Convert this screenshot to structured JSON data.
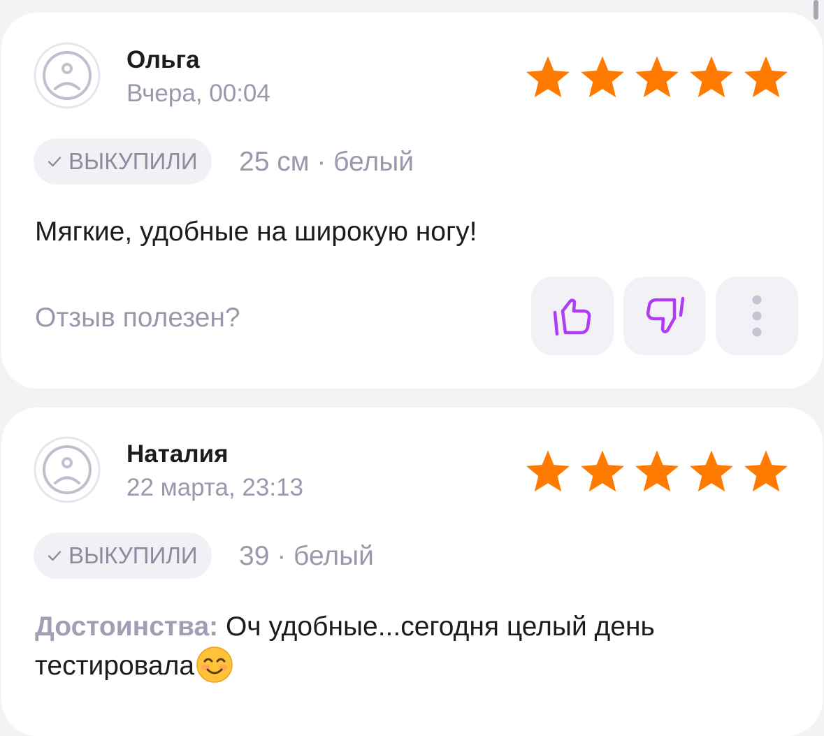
{
  "colors": {
    "star": "#ff7a00",
    "accent": "#b03cf5",
    "muted_text": "#9b98ad",
    "text": "#1c1c1e"
  },
  "reviews": [
    {
      "author": "Ольга",
      "date": "Вчера, 00:04",
      "rating": 5,
      "badge": "ВЫКУПИЛИ",
      "variant": "25 см · белый",
      "text": "Мягкие, удобные на широкую ногу!",
      "helpful_question": "Отзыв полезен?"
    },
    {
      "author": "Наталия",
      "date": "22 марта, 23:13",
      "rating": 5,
      "badge": "ВЫКУПИЛИ",
      "variant": "39 · белый",
      "pros_label": "Достоинства:",
      "pros_text": " Оч удобные...сегодня целый день тестировала",
      "emoji": "smiling-face-emoji"
    }
  ],
  "icons": {
    "avatar": "sad-face-avatar-icon",
    "rating": "star-icon",
    "badge": "check-icon",
    "like": "thumbs-up-icon",
    "dislike": "thumbs-down-icon",
    "more": "more-vertical-icon"
  }
}
